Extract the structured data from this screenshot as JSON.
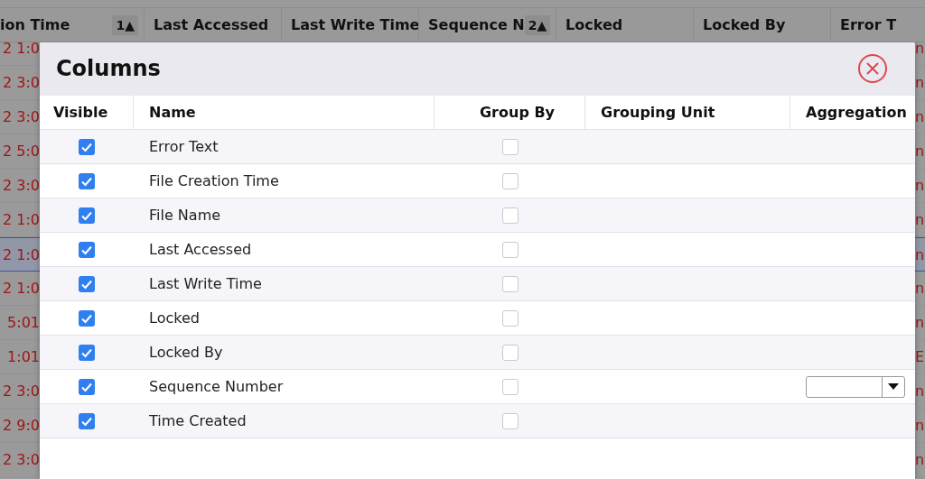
{
  "background_grid": {
    "columns": [
      {
        "label": "ion Time",
        "sort": "1▲"
      },
      {
        "label": "Last Accessed"
      },
      {
        "label": "Last Write Time"
      },
      {
        "label": "Sequence N",
        "sort": "2▲"
      },
      {
        "label": "Locked"
      },
      {
        "label": "Locked By"
      },
      {
        "label": "Error T"
      }
    ],
    "rows": [
      {
        "left": "2 1:0",
        "right": "n",
        "selected": false
      },
      {
        "left": "2 3:0",
        "right": "n",
        "selected": false
      },
      {
        "left": "2 3:0",
        "right": "n",
        "selected": false
      },
      {
        "left": "2 5:0",
        "right": "n",
        "selected": false
      },
      {
        "left": "2 3:0",
        "right": "n",
        "selected": false
      },
      {
        "left": "2 1:0",
        "right": "n",
        "selected": false
      },
      {
        "left": "2 1:0",
        "right": "n",
        "selected": true
      },
      {
        "left": "2 1:0",
        "right": "n",
        "selected": false
      },
      {
        "left": "5:01",
        "right": "n",
        "selected": false
      },
      {
        "left": "1:01",
        "right": "E",
        "selected": false
      },
      {
        "left": "2 3:0",
        "right": "n",
        "selected": false
      },
      {
        "left": "2 9:0",
        "right": "n",
        "selected": false
      },
      {
        "left": "2 3:0",
        "right": "n",
        "selected": false
      }
    ]
  },
  "dialog": {
    "title": "Columns",
    "headers": [
      "Visible",
      "Name",
      "Group By",
      "Grouping Unit",
      "Aggregation"
    ],
    "rows": [
      {
        "name": "Error Text",
        "visible": true,
        "group_by": false
      },
      {
        "name": "File Creation Time",
        "visible": true,
        "group_by": false
      },
      {
        "name": "File Name",
        "visible": true,
        "group_by": false
      },
      {
        "name": "Last Accessed",
        "visible": true,
        "group_by": false
      },
      {
        "name": "Last Write Time",
        "visible": true,
        "group_by": false
      },
      {
        "name": "Locked",
        "visible": true,
        "group_by": false
      },
      {
        "name": "Locked By",
        "visible": true,
        "group_by": false
      },
      {
        "name": "Sequence Number",
        "visible": true,
        "group_by": false,
        "aggregation": {
          "kind": "dropdown"
        }
      },
      {
        "name": "Time Created",
        "visible": true,
        "group_by": false
      }
    ]
  }
}
